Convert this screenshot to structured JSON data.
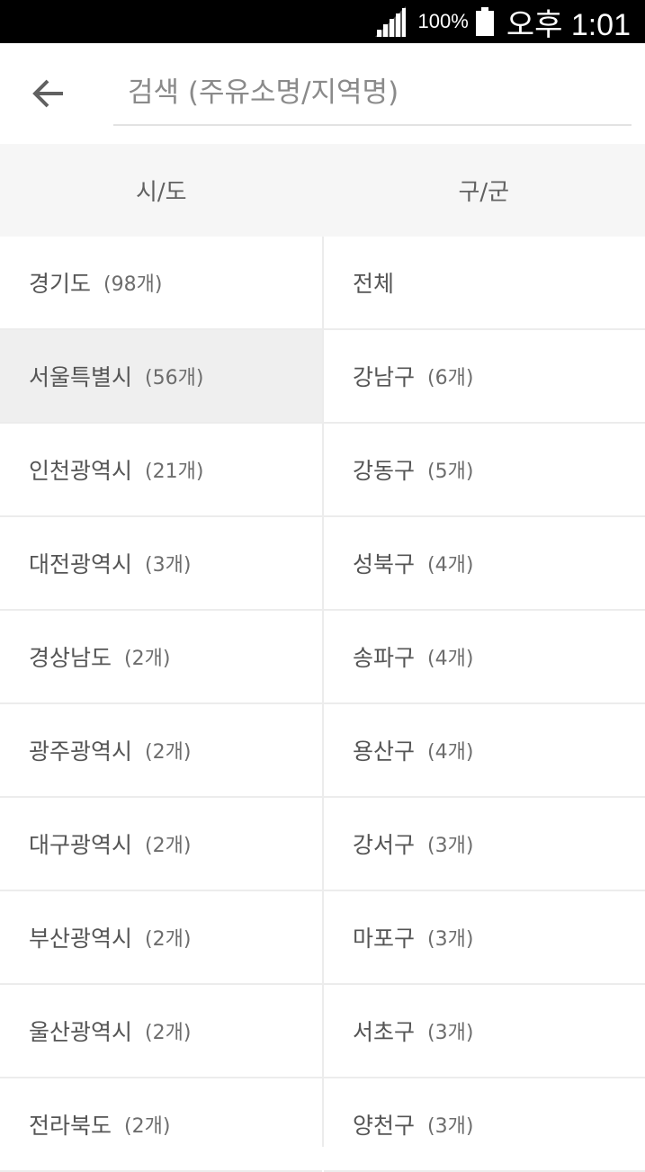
{
  "status_bar": {
    "battery": "100%",
    "time": "오후 1:01"
  },
  "search": {
    "placeholder": "검색 (주유소명/지역명)",
    "value": ""
  },
  "columns": {
    "left_header": "시/도",
    "right_header": "구/군"
  },
  "provinces": [
    {
      "name": "경기도",
      "count": "(98개)"
    },
    {
      "name": "서울특별시",
      "count": "(56개)"
    },
    {
      "name": "인천광역시",
      "count": "(21개)"
    },
    {
      "name": "대전광역시",
      "count": "(3개)"
    },
    {
      "name": "경상남도",
      "count": "(2개)"
    },
    {
      "name": "광주광역시",
      "count": "(2개)"
    },
    {
      "name": "대구광역시",
      "count": "(2개)"
    },
    {
      "name": "부산광역시",
      "count": "(2개)"
    },
    {
      "name": "울산광역시",
      "count": "(2개)"
    },
    {
      "name": "전라북도",
      "count": "(2개)"
    }
  ],
  "selected_province": "서울특별시",
  "districts": [
    {
      "name": "전체",
      "count": ""
    },
    {
      "name": "강남구",
      "count": "(6개)"
    },
    {
      "name": "강동구",
      "count": "(5개)"
    },
    {
      "name": "성북구",
      "count": "(4개)"
    },
    {
      "name": "송파구",
      "count": "(4개)"
    },
    {
      "name": "용산구",
      "count": "(4개)"
    },
    {
      "name": "강서구",
      "count": "(3개)"
    },
    {
      "name": "마포구",
      "count": "(3개)"
    },
    {
      "name": "서초구",
      "count": "(3개)"
    },
    {
      "name": "양천구",
      "count": "(3개)"
    }
  ]
}
